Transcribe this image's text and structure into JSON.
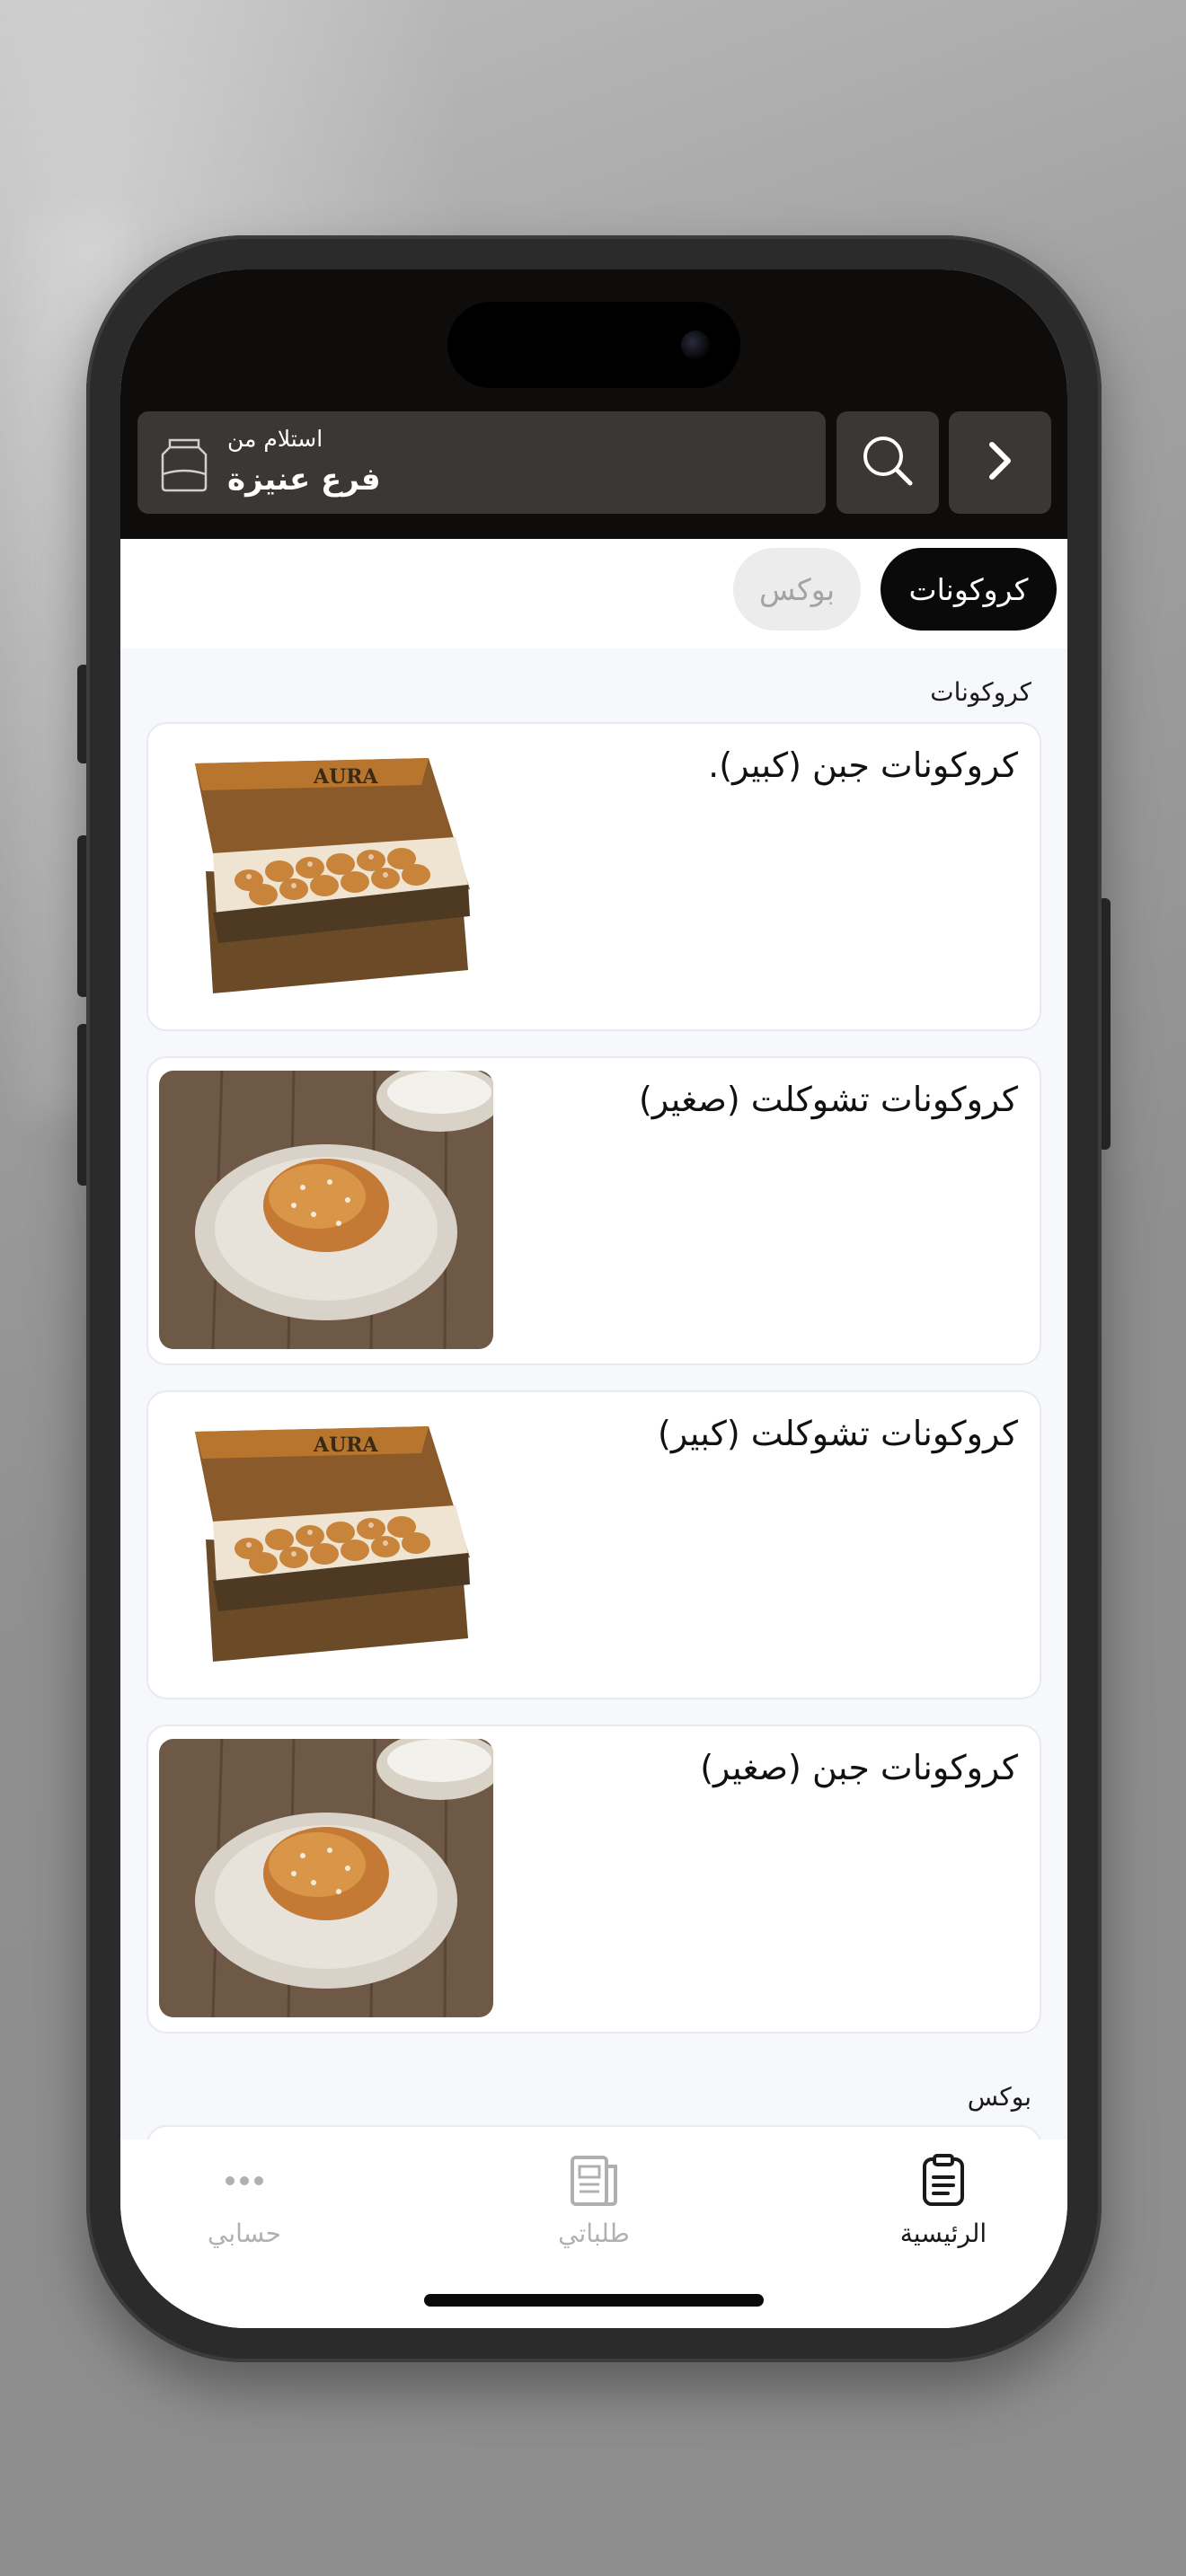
{
  "header": {
    "back_icon": "chevron-right-icon",
    "search_icon": "search-icon",
    "pickup_label": "استلام من",
    "pickup_branch": "فرع عنيزة",
    "pickup_icon": "bag-icon"
  },
  "tabs": [
    {
      "label": "كروكونات",
      "active": true
    },
    {
      "label": "بوكس",
      "active": false
    }
  ],
  "sections": [
    {
      "title": "كروكونات",
      "items": [
        {
          "name": "كروكونات جبن (كبير).",
          "image": "aura-box-photo"
        },
        {
          "name": "كروكونات تشوكلت (صغير)",
          "image": "single-croissant-plate-photo"
        },
        {
          "name": "كروكونات تشوكلت (كبير)",
          "image": "aura-box-photo"
        },
        {
          "name": "كروكونات جبن (صغير)",
          "image": "single-croissant-plate-photo"
        }
      ]
    },
    {
      "title": "بوكس",
      "items": []
    }
  ],
  "box_brand": "AURA",
  "bottom_nav": [
    {
      "label": "الرئيسية",
      "icon": "clipboard-icon",
      "active": true
    },
    {
      "label": "طلباتي",
      "icon": "orders-icon",
      "active": false
    },
    {
      "label": "حسابي",
      "icon": "more-dots-icon",
      "active": false
    }
  ],
  "colors": {
    "active_tab_bg": "#0a0a0a",
    "inactive_tab_bg": "#ececec",
    "header_bg": "#0f0d0b",
    "nav_active": "#1a1a1a",
    "nav_inactive": "#b0b0b0"
  }
}
